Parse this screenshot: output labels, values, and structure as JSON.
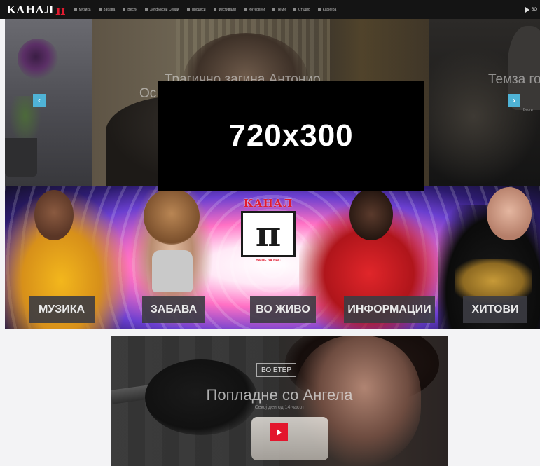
{
  "header": {
    "logo_text": "КАНАЛ",
    "logo_mark": "π",
    "menu": [
      {
        "label": "Музика"
      },
      {
        "label": "Забава"
      },
      {
        "label": "Вести"
      },
      {
        "label": "Хотфиксни Серии"
      },
      {
        "label": "Процеси"
      },
      {
        "label": "Фестивали"
      },
      {
        "label": "Интервјуи"
      },
      {
        "label": "Теми"
      },
      {
        "label": "Студио"
      },
      {
        "label": "Кариера"
      }
    ],
    "live_label": "ВО"
  },
  "slider": {
    "left_title": "Ос",
    "center_title": "Трагично загина Антонио...",
    "right_title": "Темза го",
    "right_caption": "Вести",
    "placeholder_text": "720x300",
    "prev_icon": "chevron-left",
    "next_icon": "chevron-right",
    "arrow_color": "#4fb3d6"
  },
  "banner": {
    "logo_text": "КАНАЛ",
    "logo_mark": "π",
    "logo_sub": "ВАШЕ ЗА НАС",
    "tags": [
      "МУЗИКА",
      "ЗАБАВА",
      "ВО ЖИВО",
      "ИНФОРМАЦИИ",
      "ХИТОВИ"
    ]
  },
  "featured": {
    "badge": "ВО ЕТЕР",
    "title": "Попладне со Ангела",
    "subtitle": "Секој ден од 14 часот",
    "play_icon": "play-icon",
    "accent": "#e3162d"
  }
}
